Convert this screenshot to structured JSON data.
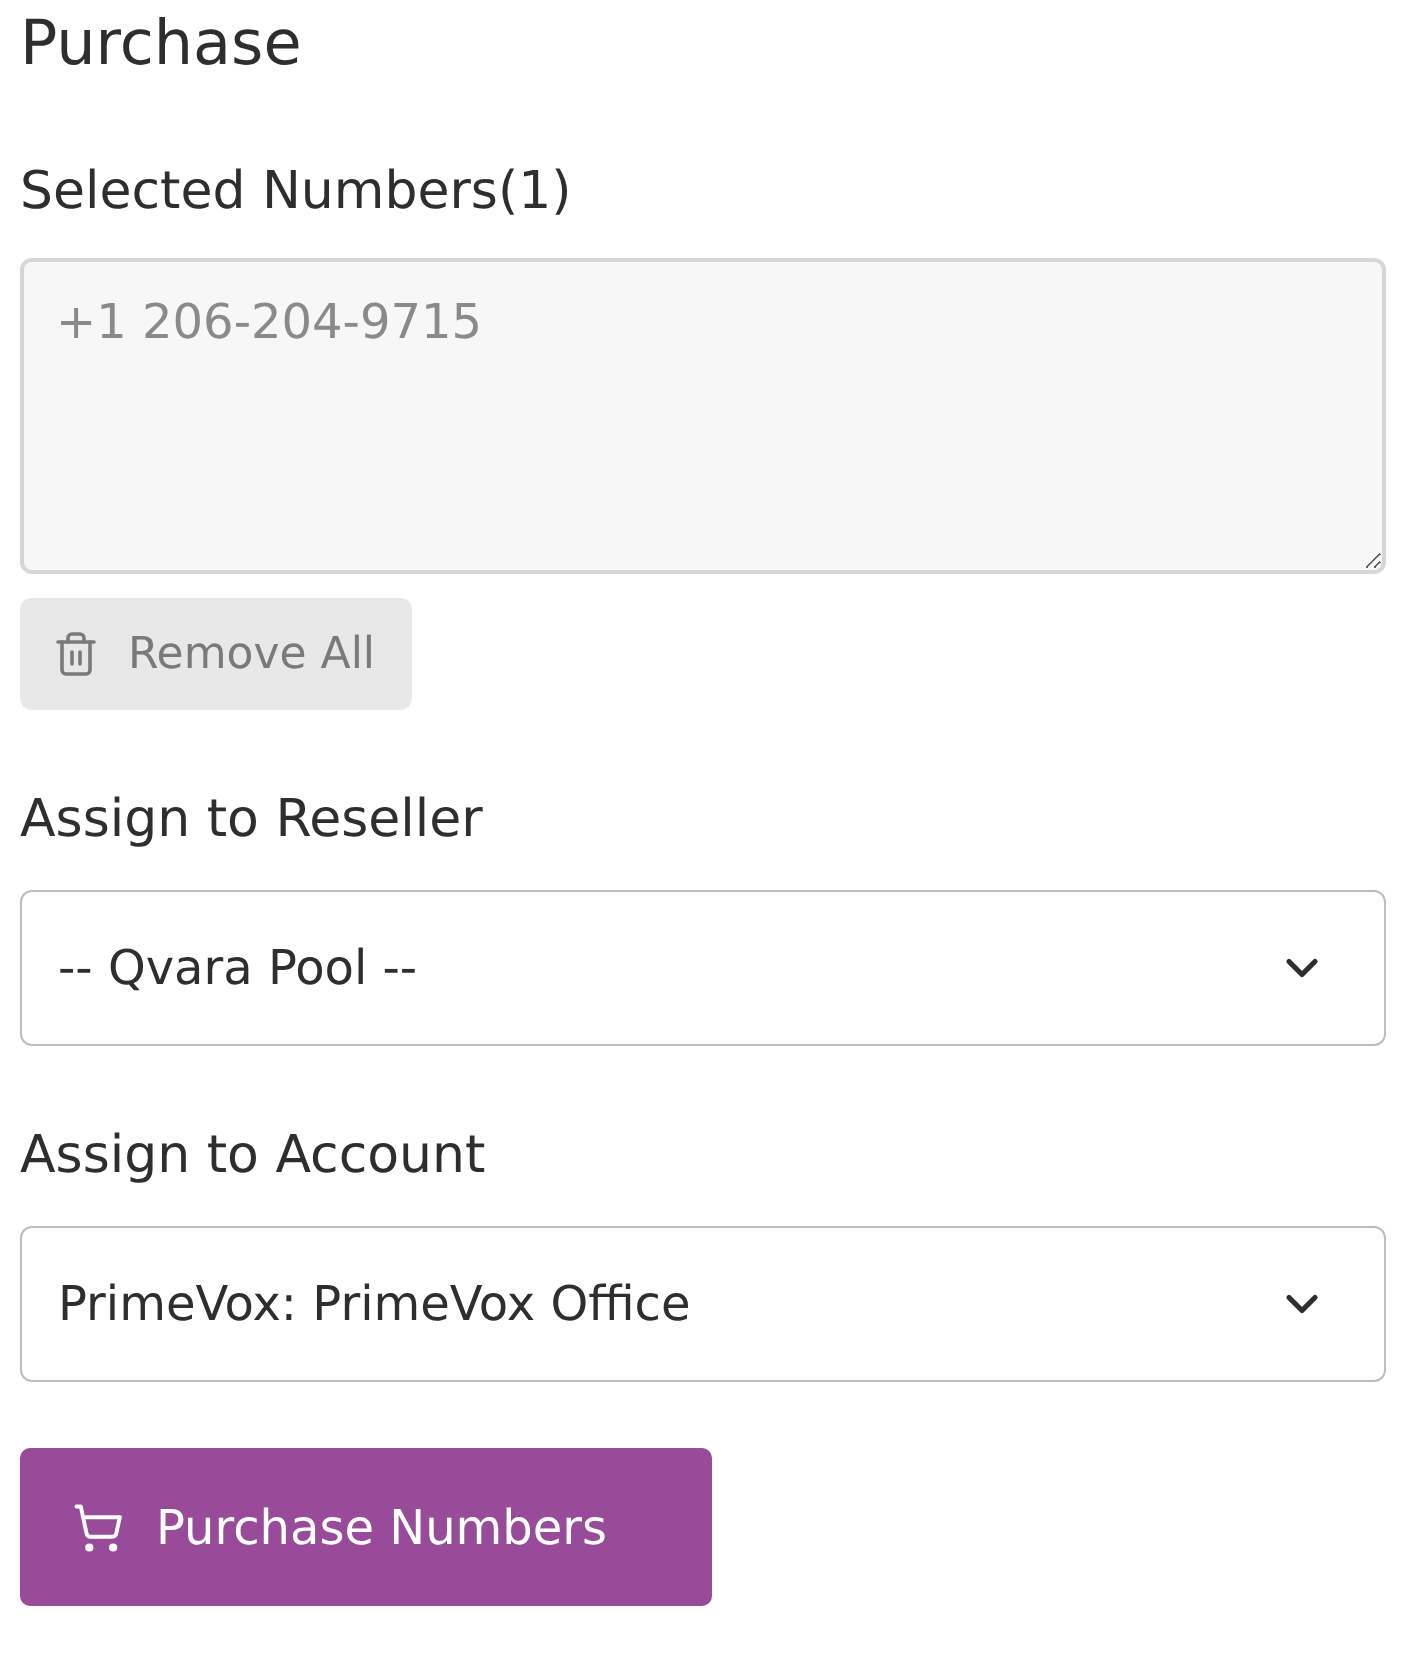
{
  "title": "Purchase",
  "selected_numbers": {
    "label": "Selected Numbers(1)",
    "value": "+1 206-204-9715",
    "disabled": true
  },
  "remove_all_button": {
    "label": "Remove All"
  },
  "reseller": {
    "label": "Assign to Reseller",
    "value": "-- Qvara Pool --"
  },
  "account": {
    "label": "Assign to Account",
    "value": "PrimeVox: PrimeVox Office"
  },
  "purchase_button": {
    "label": "Purchase Numbers"
  }
}
